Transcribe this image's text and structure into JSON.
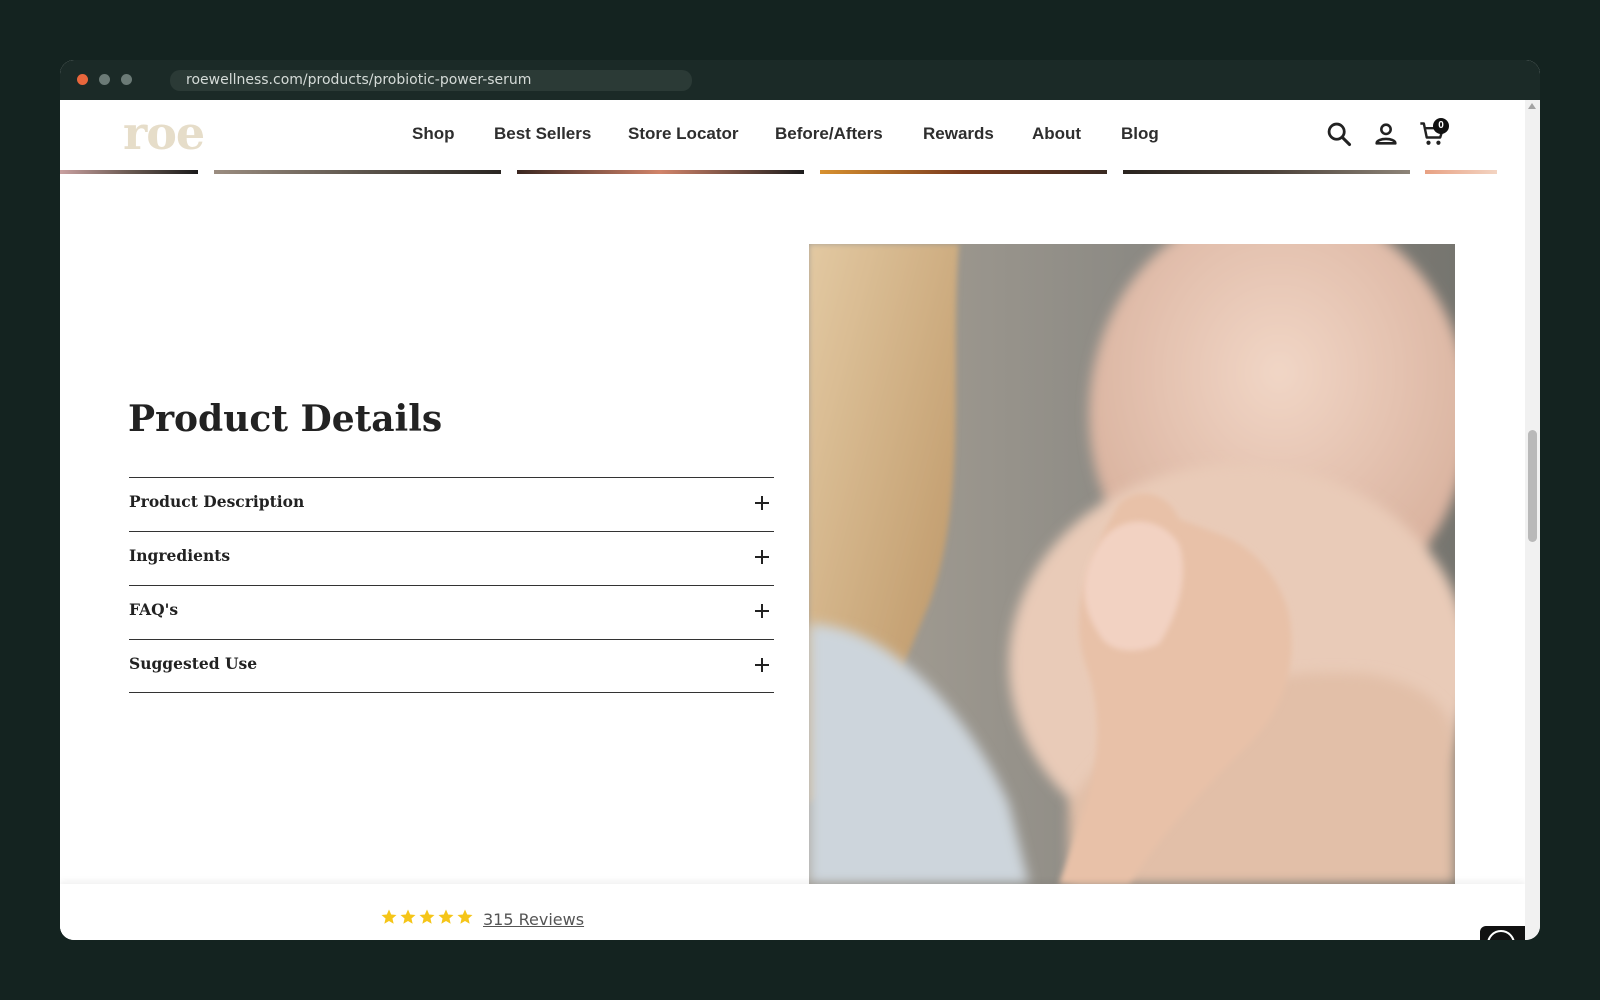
{
  "browser": {
    "url": "roewellness.com/products/probiotic-power-serum"
  },
  "header": {
    "logo": "roe",
    "nav": [
      "Shop",
      "Best Sellers",
      "Store Locator",
      "Before/Afters",
      "Rewards",
      "About",
      "Blog"
    ],
    "cart_count": "0",
    "icons": [
      "search-icon",
      "account-icon",
      "cart-icon"
    ]
  },
  "details": {
    "title": "Product Details",
    "sections": [
      "Product Description",
      "Ingredients",
      "FAQ's",
      "Suggested Use"
    ]
  },
  "reviews": {
    "rating": 5,
    "label": "315 Reviews",
    "star_color": "#f5c518"
  },
  "colors": {
    "logo": "#e6ddc9",
    "page_bg": "#142320",
    "titlebar": "#1b2a27"
  }
}
